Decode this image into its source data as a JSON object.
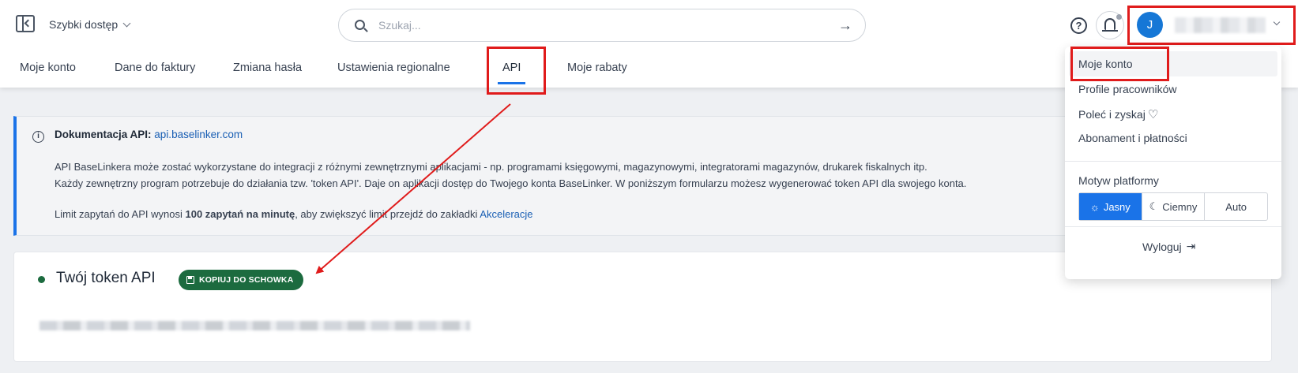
{
  "header": {
    "quick_access": "Szybki dostęp",
    "search_placeholder": "Szukaj...",
    "help_symbol": "?",
    "avatar_letter": "J"
  },
  "tabs": [
    {
      "label": "Moje konto"
    },
    {
      "label": "Dane do faktury"
    },
    {
      "label": "Zmiana hasła"
    },
    {
      "label": "Ustawienia regionalne"
    },
    {
      "label": "API",
      "active": true
    },
    {
      "label": "Moje rabaty"
    }
  ],
  "info": {
    "icon": "i",
    "title_label": "Dokumentacja API:",
    "title_link": "api.baselinker.com",
    "line1": "API BaseLinkera może zostać wykorzystane do integracji z różnymi zewnętrznymi aplikacjami - np. programami księgowymi, magazynowymi, integratorami magazynów, drukarek fiskalnych itp.",
    "line2": "Każdy zewnętrzny program potrzebuje do działania tzw. 'token API'. Daje on aplikacji dostęp do Twojego konta BaseLinker. W poniższym formularzu możesz wygenerować token API dla swojego konta.",
    "limit_prefix": "Limit zapytań do API wynosi ",
    "limit_value": "100 zapytań na minutę",
    "limit_mid": ", aby zwiększyć limit przejdź do zakładki ",
    "limit_link": "Akceleracje"
  },
  "token": {
    "title": "Twój token API",
    "copy_button": "KOPIUJ DO SCHOWKA"
  },
  "dropdown": {
    "items": [
      {
        "label": "Moje konto"
      },
      {
        "label": "Profile pracowników"
      },
      {
        "label": "Poleć i zyskaj"
      },
      {
        "label": "Abonament i płatności"
      }
    ],
    "theme_label": "Motyw platformy",
    "theme_options": [
      {
        "label": "Jasny",
        "active": true
      },
      {
        "label": "Ciemny"
      },
      {
        "label": "Auto"
      }
    ],
    "logout": "Wyloguj"
  },
  "colors": {
    "accent": "#1a73e8",
    "annotation_red": "#e01b1b",
    "success_green": "#1c6b3f"
  }
}
